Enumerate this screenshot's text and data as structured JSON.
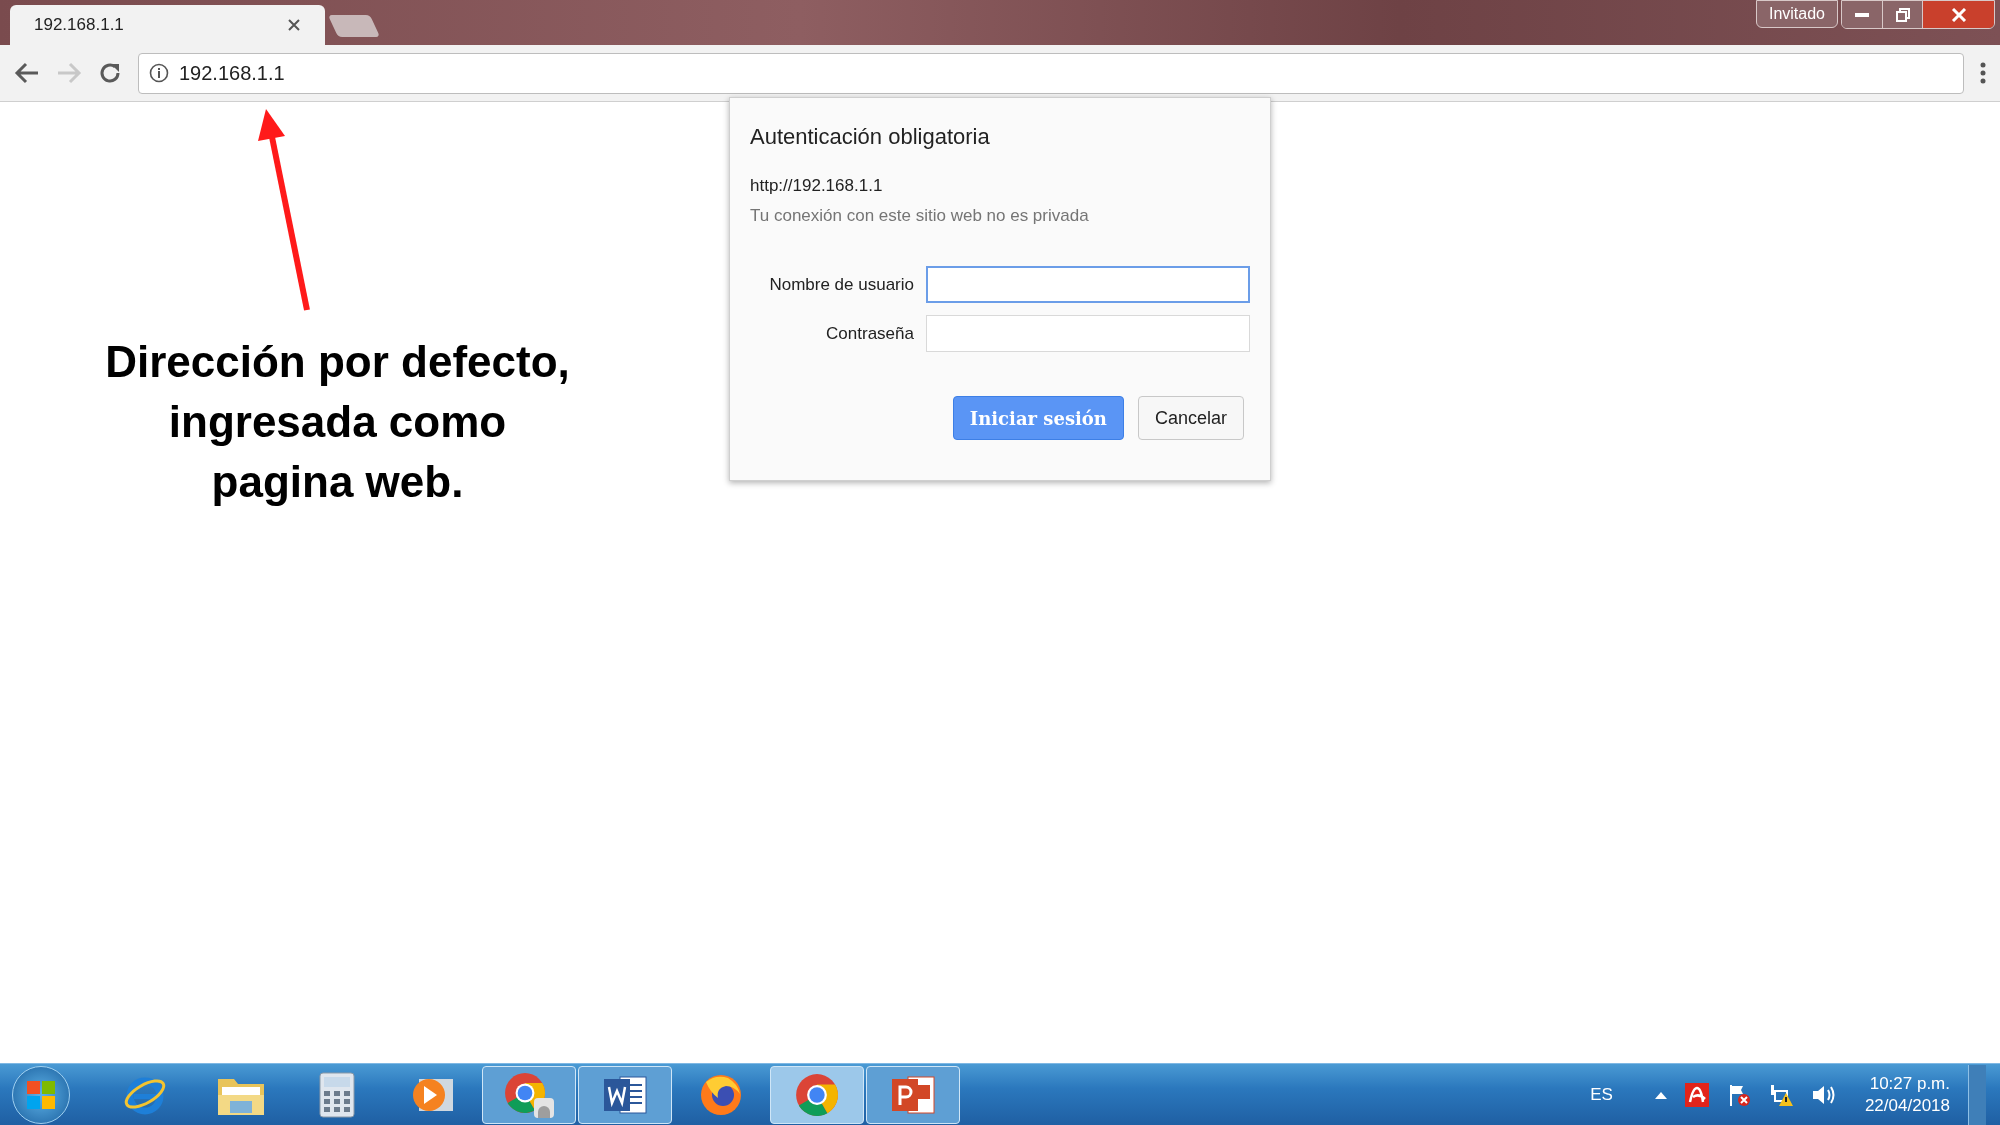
{
  "browser": {
    "tab": {
      "title": "192.168.1.1"
    },
    "profile_button": "Invitado",
    "back_disabled": false,
    "forward_disabled": true,
    "address_bar": {
      "value": "192.168.1.1"
    }
  },
  "dialog": {
    "title": "Autenticación obligatoria",
    "origin": "http://192.168.1.1",
    "note": "Tu conexión con este sitio web no es privada",
    "fields": [
      {
        "label": "Nombre de usuario",
        "focused": true
      },
      {
        "label": "Contraseña",
        "focused": false
      }
    ],
    "buttons": [
      {
        "label": "Iniciar sesión",
        "kind": "primary"
      },
      {
        "label": "Cancelar",
        "kind": "secondary"
      }
    ]
  },
  "annotation": {
    "lines": [
      "Dirección por defecto,",
      "ingresada como",
      "pagina web."
    ]
  },
  "taskbar": {
    "apps": [
      {
        "kind": "ie",
        "running": false,
        "selected": false
      },
      {
        "kind": "folder",
        "running": false,
        "selected": false
      },
      {
        "kind": "calculator",
        "running": false,
        "selected": false
      },
      {
        "kind": "media",
        "running": false,
        "selected": false
      },
      {
        "kind": "chrome-user",
        "running": true,
        "selected": false
      },
      {
        "kind": "word",
        "running": true,
        "selected": false
      },
      {
        "kind": "firefox",
        "running": false,
        "selected": false
      },
      {
        "kind": "chrome",
        "running": true,
        "selected": true
      },
      {
        "kind": "powerpoint",
        "running": true,
        "selected": false
      }
    ],
    "language": "ES",
    "clock": {
      "time": "10:27 p.m.",
      "date": "22/04/2018"
    }
  }
}
